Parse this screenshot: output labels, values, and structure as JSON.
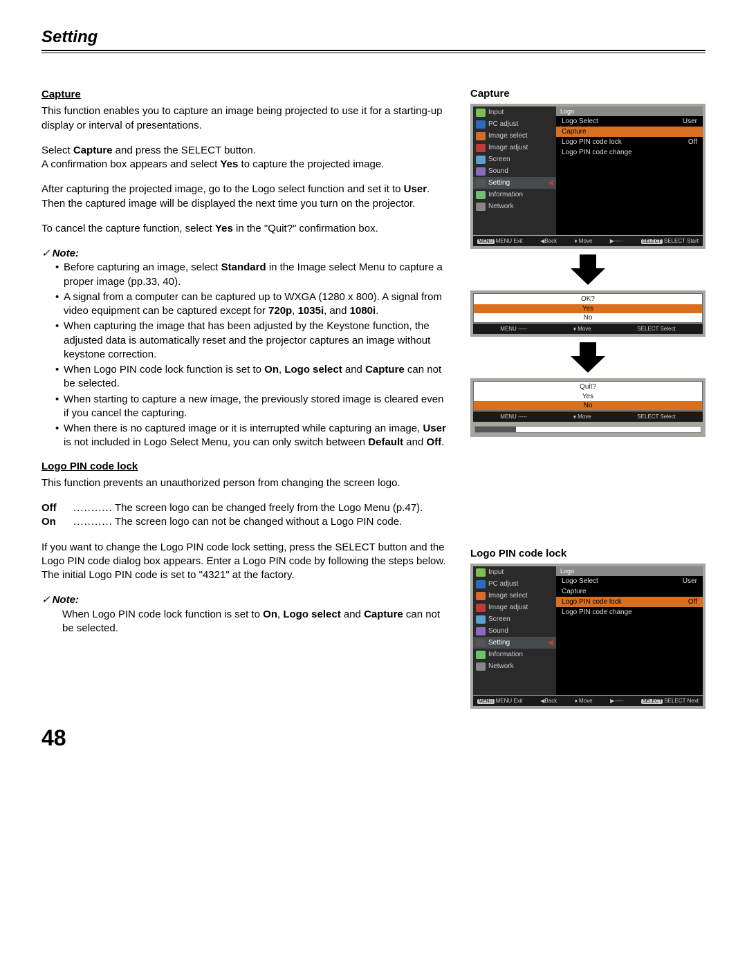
{
  "header": {
    "title": "Setting"
  },
  "page_number": "48",
  "left": {
    "capture_heading": "Capture",
    "capture_p1": "This function enables you to capture an image being projected to use it for a starting-up display or interval of presentations.",
    "capture_p2a": "Select ",
    "capture_p2b": "Capture",
    "capture_p2c": " and press the SELECT button.",
    "capture_p3a": "A confirmation box appears and select ",
    "capture_p3b": "Yes",
    "capture_p3c": " to capture the projected image.",
    "capture_p4a": "After capturing the projected image, go to the Logo select function and set it to ",
    "capture_p4b": "User",
    "capture_p4c": ". Then the captured image will be displayed the next time you turn on the projector.",
    "capture_p5a": "To cancel the capture function, select ",
    "capture_p5b": "Yes",
    "capture_p5c": " in the \"Quit?\" confirmation box.",
    "note_label": "Note:",
    "notes1": {
      "n1a": "Before capturing an image, select ",
      "n1b": "Standard",
      "n1c": " in the Image select Menu to capture a proper image (pp.33, 40).",
      "n2a": "A signal from a computer can be captured up to WXGA (1280 x 800). A signal from video equipment can be captured except for ",
      "n2b": "720p",
      "n2c": ", ",
      "n2d": "1035i",
      "n2e": ", and ",
      "n2f": "1080i",
      "n2g": ".",
      "n3": "When capturing the image that has been adjusted by the Keystone function, the adjusted data is automatically reset and the projector captures an image without keystone correction.",
      "n4a": "When Logo PIN code lock function is set to ",
      "n4b": "On",
      "n4c": ", ",
      "n4d": "Logo select",
      "n4e": " and ",
      "n4f": "Capture",
      "n4g": " can not be selected.",
      "n5": "When starting to capture a new image, the previously stored image is cleared even if you cancel the capturing.",
      "n6a": "When there is no captured image or it is interrupted while capturing an image, ",
      "n6b": "User",
      "n6c": " is not included in Logo Select Menu, you can only switch between ",
      "n6d": "Default",
      "n6e": " and ",
      "n6f": "Off",
      "n6g": "."
    },
    "pin_heading": "Logo PIN code lock",
    "pin_p1": "This function prevents an unauthorized person from changing the screen logo.",
    "off_label": "Off",
    "off_def": "The screen logo can be changed freely from the Logo Menu (p.47).",
    "on_label": "On",
    "on_def": "The screen logo can not be changed without a Logo PIN code.",
    "pin_p2": "If you want to change the Logo PIN code lock setting, press the SELECT button and the Logo PIN code dialog box appears. Enter a Logo PIN code by following the steps below. The initial Logo PIN code is set to \"4321\" at the factory.",
    "notes2a": "When Logo PIN code lock function is set to ",
    "notes2b": "On",
    "notes2c": ", ",
    "notes2d": "Logo select",
    "notes2e": " and ",
    "notes2f": "Capture",
    "notes2g": " can not be selected."
  },
  "right": {
    "capture_title": "Capture",
    "pin_title": "Logo PIN code lock",
    "side_items": [
      "Input",
      "PC adjust",
      "Image select",
      "Image adjust",
      "Screen",
      "Sound",
      "Setting",
      "Information",
      "Network"
    ],
    "panel_head": "Logo",
    "logo_rows": [
      {
        "label": "Logo Select",
        "value": "User"
      },
      {
        "label": "Capture",
        "value": ""
      },
      {
        "label": "Logo PIN code lock",
        "value": "Off"
      },
      {
        "label": "Logo PIN code change",
        "value": ""
      }
    ],
    "hint1": {
      "a": "MENU Exit",
      "b": "◀Back",
      "c": "♦ Move",
      "d": "▶-----",
      "e": "SELECT Start"
    },
    "hint1b": {
      "a": "MENU Exit",
      "b": "◀Back",
      "c": "♦ Move",
      "d": "▶-----",
      "e": "SELECT Next"
    },
    "ok_dialog": {
      "q": "OK?",
      "yes": "Yes",
      "no": "No"
    },
    "dlg_hint": {
      "a": "MENU -----",
      "b": "♦ Move",
      "c": "SELECT Select"
    },
    "quit_dialog": {
      "q": "Quit?",
      "yes": "Yes",
      "no": "No"
    }
  },
  "icon_colors": [
    "#7fbf4f",
    "#2a6bbd",
    "#d86b2a",
    "#c03a3a",
    "#5aa0d0",
    "#8a6bbf",
    "#555",
    "#6fbf6f",
    "#888"
  ]
}
